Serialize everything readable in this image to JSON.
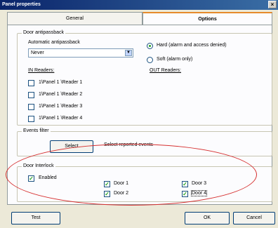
{
  "window": {
    "title": "Panel properties",
    "close_glyph": "×"
  },
  "tabs": {
    "general": "General",
    "options": "Options"
  },
  "door_antipassback": {
    "title": "Door antipassback",
    "automatic_label": "Automatic antipassback",
    "automatic_value": "Never",
    "hard_label": "Hard (alarm and access denied)",
    "soft_label": "Soft (alarm only)",
    "selected_mode": "hard",
    "in_readers_label": "IN Readers:",
    "out_readers_label": "OUT Readers:",
    "in_readers": [
      {
        "label": "1\\Panel 1 \\Reader 1",
        "checked": false
      },
      {
        "label": "1\\Panel 1 \\Reader 2",
        "checked": false
      },
      {
        "label": "1\\Panel 1 \\Reader 3",
        "checked": false
      },
      {
        "label": "1\\Panel 1 \\Reader 4",
        "checked": false
      }
    ]
  },
  "events_filter": {
    "title": "Events filter",
    "select_button": "Select",
    "description": "Select reported events"
  },
  "door_interlock": {
    "title": "Door Interlock",
    "enabled_label": "Enabled",
    "enabled": true,
    "doors": [
      {
        "label": "Door 1",
        "checked": true
      },
      {
        "label": "Door 2",
        "checked": true
      },
      {
        "label": "Door 3",
        "checked": true
      },
      {
        "label": "Door 4",
        "checked": true
      }
    ]
  },
  "buttons": {
    "test": "Test",
    "ok": "OK",
    "cancel": "Cancel"
  },
  "colors": {
    "annotation_ellipse": "#d63030",
    "check_mark": "#21a121"
  }
}
